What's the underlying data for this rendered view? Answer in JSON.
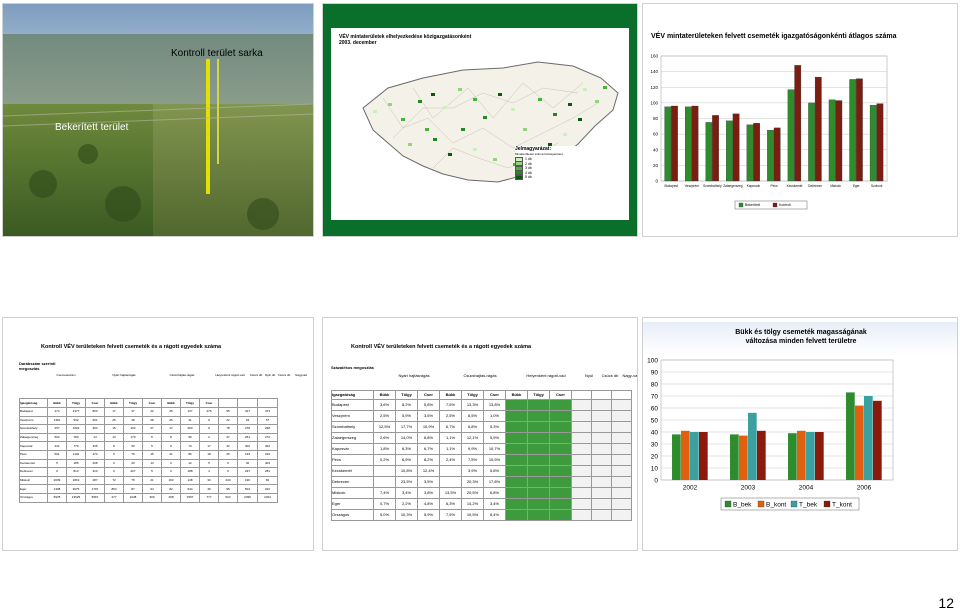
{
  "page_number": "12",
  "slide1": {
    "title": "Kontroll terület sarka",
    "caption": "Bekerített terület"
  },
  "slide2": {
    "map_title": "VÉV mintaterületek elhelyezkedése közigazgatásonként 2003. december",
    "legend_title": "Jelmagyarázat:",
    "legend_subtitle": "Mintaterületek száma községenként",
    "legend_items": [
      "1 db",
      "2 db",
      "3 db",
      "4 db",
      "5 db"
    ],
    "legend_colors": [
      "#ccefc0",
      "#8fd67a",
      "#4db03a",
      "#218a1c",
      "#0b5a0b"
    ],
    "map_fill": "#f3f1e8",
    "map_border": "#6a6a6a"
  },
  "slide3": {
    "title": "VÉV mintaterületeken felvett csemeték igazgatóságonkénti átlagos száma",
    "chart_data": {
      "type": "bar",
      "categories": [
        "Budapest",
        "Veszprém",
        "Szombathely",
        "Zalaegerszeg",
        "Kaposvár",
        "Pécs",
        "Kecskemét",
        "Debrecen",
        "Miskolc",
        "Eger",
        "Szolnok"
      ],
      "series": [
        {
          "name": "Bekerített",
          "color": "#2e8b2e",
          "values": [
            95,
            95,
            75,
            77,
            72,
            65,
            117,
            100,
            104,
            130,
            97
          ]
        },
        {
          "name": "Kontroll",
          "color": "#7a1e12",
          "values": [
            96,
            96,
            84,
            86,
            74,
            68,
            148,
            133,
            103,
            131,
            99
          ]
        }
      ],
      "ylim": [
        0,
        160
      ],
      "yticks": [
        0,
        20,
        40,
        60,
        80,
        100,
        120,
        140,
        160
      ],
      "legend_position": "bottom"
    }
  },
  "slide4": {
    "title": "Kontroll VÉV területeken felvett csemeték és a rágott egyedek száma",
    "subtitle": "Darabszám szerinti megoszlás",
    "headers": [
      "Igazgatóság",
      "Bükk",
      "Tölgy",
      "Cser",
      "Bükk",
      "Tölgy",
      "Cser",
      "Bükk",
      "Tölgy",
      "Cser",
      "",
      "",
      ""
    ],
    "group_headers": [
      "Csemeteszám",
      "Nyári hajtásrágás",
      "Csúcshajtás-rágás",
      "Helyenként rágott-vad",
      "Csúcs db",
      "Nyár db",
      "Csúcs db",
      "Nagyvad"
    ],
    "rows": [
      [
        "Budapest",
        "474",
        "1377",
        "803",
        "17",
        "37",
        "22",
        "25",
        "137",
        "276",
        "55",
        "327",
        "373"
      ],
      [
        "Veszprém",
        "1361",
        "532",
        "901",
        "25",
        "28",
        "28",
        "25",
        "31",
        "9",
        "22",
        "63",
        "57"
      ],
      [
        "Szombathely",
        "257",
        "1023",
        "304",
        "15",
        "102",
        "27",
        "17",
        "260",
        "9",
        "78",
        "278",
        "268"
      ],
      [
        "Zalaegerszeg",
        "502",
        "780",
        "14",
        "13",
        "170",
        "5",
        "8",
        "99",
        "2",
        "47",
        "251",
        "272"
      ],
      [
        "Kaposvár",
        "441",
        "779",
        "335",
        "8",
        "52",
        "5",
        "9",
        "73",
        "17",
        "32",
        "302",
        "302"
      ],
      [
        "Pécs",
        "591",
        "1142",
        "474",
        "5",
        "76",
        "15",
        "21",
        "86",
        "18",
        "25",
        "193",
        "226"
      ],
      [
        "Kecskemét",
        "5",
        "185",
        "408",
        "0",
        "20",
        "13",
        "0",
        "12",
        "5",
        "0",
        "40",
        "404"
      ],
      [
        "Debrecen",
        "0",
        "813",
        "313",
        "0",
        "227",
        "5",
        "0",
        "188",
        "4",
        "0",
        "297",
        "281"
      ],
      [
        "Miskolc",
        "2039",
        "1819",
        "487",
        "72",
        "75",
        "21",
        "163",
        "148",
        "33",
        "240",
        "190",
        "82"
      ],
      [
        "Eger",
        "1308",
        "3075",
        "1797",
        "863",
        "87",
        "94",
        "82",
        "644",
        "46",
        "95",
        "504",
        "222"
      ],
      [
        "Országos",
        "5978",
        "13525",
        "5967",
        "277",
        "1048",
        "300",
        "268",
        "1597",
        "777",
        "523",
        "2495",
        "2324"
      ]
    ]
  },
  "slide5": {
    "title": "Kontroll VÉV területeken felvett csemeték és a rágott egyedek száma",
    "subtitle": "Százalékos megoszlás",
    "group_headers": [
      "Nyári hajtásrágás",
      "Csúcshajtás-rágás",
      "Helyenként rágott-vad",
      "Nyúl",
      "Csúcs db",
      "Nagy-vad"
    ],
    "headers": [
      "Igazgatóság",
      "Bükk",
      "Tölgy",
      "Cser",
      "Bükk",
      "Tölgy",
      "Cser",
      "Bükk",
      "Tölgy",
      "Cser",
      "",
      "",
      ""
    ],
    "rows": [
      [
        "Budapest",
        "3,6%",
        "8,2%",
        "5,8%",
        "7,5%",
        "13,3%",
        "13,8%",
        "",
        "",
        "",
        "",
        "",
        ""
      ],
      [
        "Veszprém",
        "2,5%",
        "5,9%",
        "3,5%",
        "2,5%",
        "8,5%",
        "1,0%",
        "",
        "",
        "",
        "",
        "",
        ""
      ],
      [
        "Szombathely",
        "12,5%",
        "17,7%",
        "10,9%",
        "6,7%",
        "6,8%",
        "5,3%",
        "",
        "",
        "",
        "",
        "",
        ""
      ],
      [
        "Zalaegerszeg",
        "2,6%",
        "14,0%",
        "6,8%",
        "1,1%",
        "12,1%",
        "5,9%",
        "",
        "",
        "",
        "",
        "",
        ""
      ],
      [
        "Kaposvár",
        "1,8%",
        "6,3%",
        "6,7%",
        "1,1%",
        "9,9%",
        "10,7%",
        "",
        "",
        "",
        "",
        "",
        ""
      ],
      [
        "Pécs",
        "0,2%",
        "6,9%",
        "8,2%",
        "2,4%",
        "7,5%",
        "10,5%",
        "",
        "",
        "",
        "",
        "",
        ""
      ],
      [
        "Kecskemét",
        "",
        "10,8%",
        "12,4%",
        "",
        "3,9%",
        "5,8%",
        "",
        "",
        "",
        "",
        "",
        ""
      ],
      [
        "Debrecen",
        "",
        "23,5%",
        "3,5%",
        "",
        "20,3%",
        "17,8%",
        "",
        "",
        "",
        "",
        "",
        ""
      ],
      [
        "Miskolc",
        "7,4%",
        "3,4%",
        "3,8%",
        "13,5%",
        "20,5%",
        "6,8%",
        "",
        "",
        "",
        "",
        "",
        ""
      ],
      [
        "Eger",
        "0,7%",
        "2,2%",
        "4,8%",
        "6,3%",
        "14,2%",
        "3,4%",
        "",
        "",
        "",
        "",
        "",
        ""
      ],
      [
        "Országos",
        "5,0%",
        "10,3%",
        "5,9%",
        "7,5%",
        "10,5%",
        "8,4%",
        "",
        "",
        "",
        "",
        "",
        ""
      ]
    ]
  },
  "slide6": {
    "title": "Bükk és tölgy csemeték magasságának változása minden felvett területre",
    "chart_data": {
      "type": "bar",
      "categories": [
        "2002",
        "2003",
        "2004",
        "2006"
      ],
      "series": [
        {
          "name": "B_bek",
          "color": "#2e8b2e",
          "values": [
            38,
            38,
            39,
            73
          ]
        },
        {
          "name": "B_kont",
          "color": "#e06010",
          "values": [
            41,
            37,
            41,
            62
          ]
        },
        {
          "name": "T_bek",
          "color": "#3aa0a0",
          "values": [
            40,
            56,
            40,
            70
          ]
        },
        {
          "name": "T_kont",
          "color": "#8b1a0c",
          "values": [
            40,
            41,
            40,
            66
          ]
        }
      ],
      "ylim": [
        0,
        100
      ],
      "yticks": [
        0,
        10,
        20,
        30,
        40,
        50,
        60,
        70,
        80,
        90,
        100
      ],
      "legend_position": "bottom"
    }
  }
}
